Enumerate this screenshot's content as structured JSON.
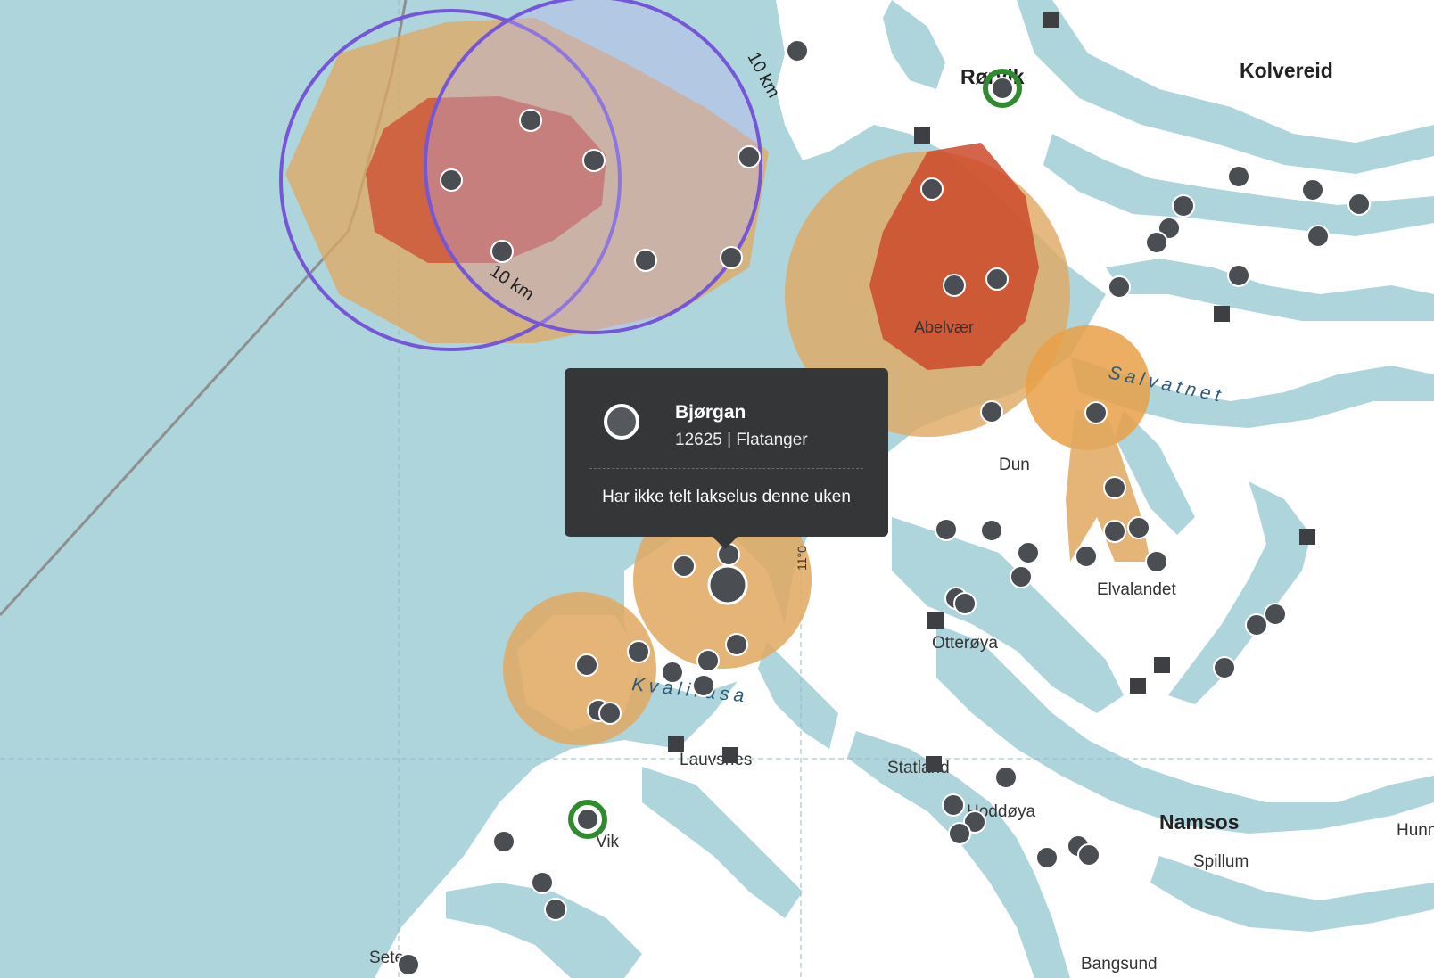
{
  "places": {
    "rorvik": "Rørvik",
    "kolvereid": "Kolvereid",
    "abelvaer": "Abelvær",
    "salvatnet": "Salvatnet",
    "dun": "Dun",
    "elvalandet": "Elvalandet",
    "otteroya": "Otterøya",
    "kvaliraasa": "Kvaliråsa",
    "lauvsnes": "Lauvsnes",
    "statland": "Statland",
    "hoddoya": "Hoddøya",
    "namsos": "Namsos",
    "spillum": "Spillum",
    "vik": "Vik",
    "seter": "Seter",
    "bangsund": "Bangsund",
    "hunn": "Hunn"
  },
  "zones": {
    "label_a": "10 km",
    "label_b": "10 km",
    "meridian": "11°0"
  },
  "tooltip": {
    "name": "Bjørgan",
    "subtitle": "12625 | Flatanger",
    "message": "Har ikke telt lakselus denne uken"
  },
  "colors": {
    "sea": "#aed4dc",
    "land": "#ffffff",
    "zone_orange": "#e0a860",
    "zone_red": "#cc4a2c",
    "circle_purple": "#7656d8",
    "marker_dark": "#4a4d52",
    "marker_green": "#2e8b2e"
  },
  "icons": {
    "site_marker": "circle-marker-icon",
    "facility_marker": "square-marker-icon",
    "active_marker": "green-ring-marker-icon"
  }
}
